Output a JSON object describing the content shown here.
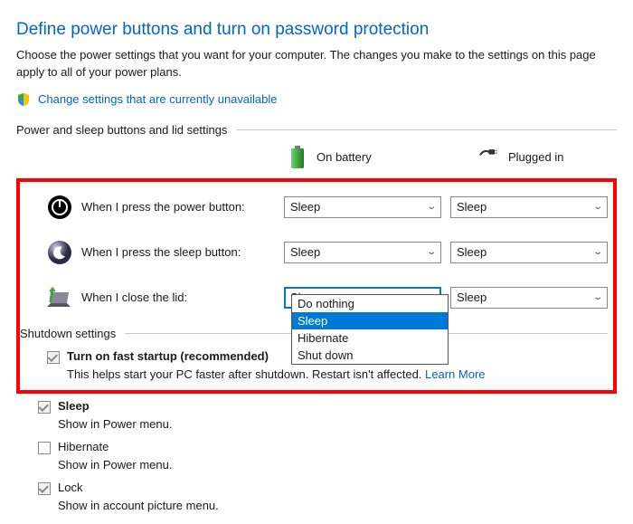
{
  "title": "Define power buttons and turn on password protection",
  "subtitle": "Choose the power settings that you want for your computer. The changes you make to the settings on this page apply to all of your power plans.",
  "change_link": "Change settings that are currently unavailable",
  "section1_title": "Power and sleep buttons and lid settings",
  "columns": {
    "battery": "On battery",
    "plugged": "Plugged in"
  },
  "rows": {
    "power": {
      "label": "When I press the power button:",
      "battery": "Sleep",
      "plugged": "Sleep"
    },
    "sleep": {
      "label": "When I press the sleep button:",
      "battery": "Sleep",
      "plugged": "Sleep"
    },
    "lid": {
      "label": "When I close the lid:",
      "battery": "Sleep",
      "plugged": "Sleep"
    }
  },
  "dropdown_options": [
    "Do nothing",
    "Sleep",
    "Hibernate",
    "Shut down"
  ],
  "dropdown_selected": "Sleep",
  "section2_title": "Shutdown settings",
  "shutdown": {
    "fast_startup": {
      "label": "Turn on fast startup (recommended)",
      "desc": "This helps start your PC faster after shutdown. Restart isn't affected. ",
      "learn_more": "Learn More"
    },
    "sleep": {
      "label": "Sleep",
      "desc": "Show in Power menu."
    },
    "hibernate": {
      "label": "Hibernate",
      "desc": "Show in Power menu."
    },
    "lock": {
      "label": "Lock",
      "desc": "Show in account picture menu."
    }
  }
}
